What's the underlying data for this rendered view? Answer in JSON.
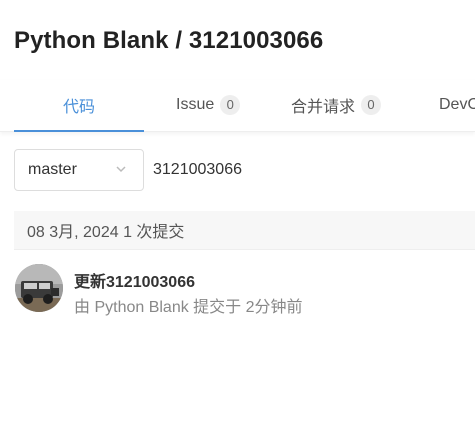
{
  "repo": {
    "title": "Python Blank / 3121003066"
  },
  "tabs": [
    {
      "label": "代码",
      "active": true
    },
    {
      "label": "Issue",
      "count": "0"
    },
    {
      "label": "合并请求",
      "count": "0"
    },
    {
      "label": "DevOps"
    }
  ],
  "branch": {
    "selected": "master",
    "path": "3121003066"
  },
  "commits": {
    "date_header": "08 3月, 2024 1 次提交",
    "items": [
      {
        "title": "更新3121003066",
        "meta": "由 Python Blank 提交于 2分钟前"
      }
    ]
  },
  "colors": {
    "accent": "#4a90d9"
  }
}
